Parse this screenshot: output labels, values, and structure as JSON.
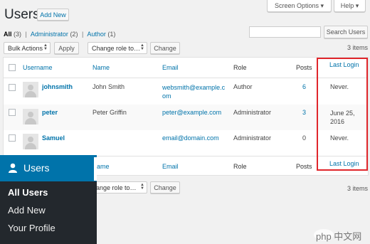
{
  "page": {
    "title": "Users",
    "add_new": "Add New"
  },
  "top_tabs": {
    "screen_options": "Screen Options ▾",
    "help": "Help ▾"
  },
  "filters": {
    "all": "All",
    "all_count": "(3)",
    "administrator": "Administrator",
    "administrator_count": "(2)",
    "author": "Author",
    "author_count": "(1)",
    "sep": "|"
  },
  "search": {
    "value": "",
    "button": "Search Users"
  },
  "bulk": {
    "select": "Bulk Actions",
    "apply": "Apply",
    "role_select": "Change role to…",
    "role_select_bottom": "hange role to…",
    "change": "Change",
    "items": "3 items"
  },
  "table": {
    "headers": {
      "username": "Username",
      "name": "Name",
      "email": "Email",
      "role": "Role",
      "posts": "Posts",
      "last_login": "Last Login"
    },
    "footers": {
      "name": "Name",
      "email": "Email",
      "role": "Role",
      "posts": "Posts",
      "last_login": "Last Login",
      "partial_left": "ame"
    },
    "rows": [
      {
        "username": "johnsmith",
        "name": "John Smith",
        "email_line1": "websmith@example.c",
        "email_line2": "om",
        "role": "Author",
        "posts": "6",
        "last_login_line1": "Never.",
        "last_login_line2": ""
      },
      {
        "username": "peter",
        "name": "Peter Griffin",
        "email_line1": "peter@example.com",
        "email_line2": "",
        "role": "Administrator",
        "posts": "3",
        "last_login_line1": "June 25,",
        "last_login_line2": "2016"
      },
      {
        "username": "Samuel",
        "name": "",
        "email_line1": "email@domain.com",
        "email_line2": "",
        "role": "Administrator",
        "posts": "0",
        "last_login_line1": "Never.",
        "last_login_line2": ""
      }
    ]
  },
  "sidebar_menu": {
    "title": "Users",
    "items": [
      "All Users",
      "Add New",
      "Your Profile"
    ]
  },
  "watermark": "php 中文网",
  "colors": {
    "link": "#0073aa",
    "menu_bg": "#23282d",
    "menu_active": "#0073aa",
    "highlight": "#e0262b"
  }
}
